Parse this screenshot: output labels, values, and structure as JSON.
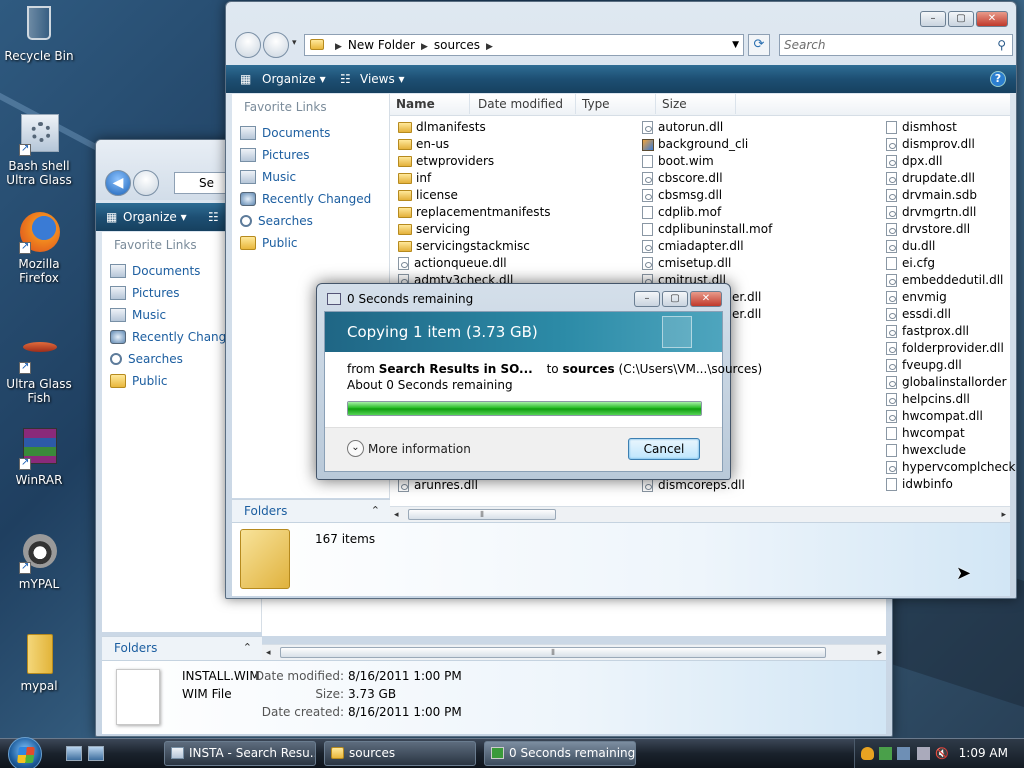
{
  "desktop": {
    "icons": [
      {
        "label": "Recycle Bin"
      },
      {
        "label": "Bash shell Ultra Glass"
      },
      {
        "label": "Mozilla Firefox"
      },
      {
        "label": "Ultra Glass Fish"
      },
      {
        "label": "WinRAR"
      },
      {
        "label": "mYPAL"
      },
      {
        "label": "mypal"
      }
    ]
  },
  "front_window": {
    "breadcrumb": [
      "New Folder",
      "sources"
    ],
    "search_placeholder": "Search",
    "toolbar": {
      "organize": "Organize",
      "views": "Views",
      "help": "?"
    },
    "favorite_links_header": "Favorite Links",
    "favorite_links": [
      "Documents",
      "Pictures",
      "Music",
      "Recently Changed",
      "Searches",
      "Public"
    ],
    "folders_label": "Folders",
    "columns": [
      "Name",
      "Date modified",
      "Type",
      "Size"
    ],
    "files_col1": [
      {
        "name": "dlmanifests",
        "kind": "folder"
      },
      {
        "name": "en-us",
        "kind": "folder"
      },
      {
        "name": "etwproviders",
        "kind": "folder"
      },
      {
        "name": "inf",
        "kind": "folder"
      },
      {
        "name": "license",
        "kind": "folder"
      },
      {
        "name": "replacementmanifests",
        "kind": "folder"
      },
      {
        "name": "servicing",
        "kind": "folder"
      },
      {
        "name": "servicingstackmisc",
        "kind": "folder"
      },
      {
        "name": "actionqueue.dll",
        "kind": "dll"
      },
      {
        "name": "admtv3check.dll",
        "kind": "dll"
      }
    ],
    "files_col1_bottom": "arunres.dll",
    "files_col2": [
      {
        "name": "autorun.dll",
        "kind": "dll"
      },
      {
        "name": "background_cli",
        "kind": "img"
      },
      {
        "name": "boot.wim",
        "kind": "file"
      },
      {
        "name": "cbscore.dll",
        "kind": "dll"
      },
      {
        "name": "cbsmsg.dll",
        "kind": "dll"
      },
      {
        "name": "cdplib.mof",
        "kind": "file"
      },
      {
        "name": "cdplibuninstall.mof",
        "kind": "file"
      },
      {
        "name": "cmiadapter.dll",
        "kind": "dll"
      },
      {
        "name": "cmisetup.dll",
        "kind": "dll"
      },
      {
        "name": "cmitrust.dll",
        "kind": "dll"
      }
    ],
    "files_col2_partial": [
      "er.dll",
      "er.dll",
      "ll"
    ],
    "files_col2_bottom": "dismcoreps.dll",
    "files_col3": [
      {
        "name": "dismhost",
        "kind": "file"
      },
      {
        "name": "dismprov.dll",
        "kind": "dll"
      },
      {
        "name": "dpx.dll",
        "kind": "dll"
      },
      {
        "name": "drupdate.dll",
        "kind": "dll"
      },
      {
        "name": "drvmain.sdb",
        "kind": "dll"
      },
      {
        "name": "drvmgrtn.dll",
        "kind": "dll"
      },
      {
        "name": "drvstore.dll",
        "kind": "dll"
      },
      {
        "name": "du.dll",
        "kind": "dll"
      },
      {
        "name": "ei.cfg",
        "kind": "file"
      },
      {
        "name": "embeddedutil.dll",
        "kind": "dll"
      },
      {
        "name": "envmig",
        "kind": "dll"
      },
      {
        "name": "essdi.dll",
        "kind": "dll"
      },
      {
        "name": "fastprox.dll",
        "kind": "dll"
      },
      {
        "name": "folderprovider.dll",
        "kind": "dll"
      },
      {
        "name": "fveupg.dll",
        "kind": "dll"
      },
      {
        "name": "globalinstallorder",
        "kind": "dll"
      },
      {
        "name": "helpcins.dll",
        "kind": "dll"
      },
      {
        "name": "hwcompat.dll",
        "kind": "dll"
      },
      {
        "name": "hwcompat",
        "kind": "file"
      },
      {
        "name": "hwexclude",
        "kind": "file"
      },
      {
        "name": "hypervcomplcheck.dll",
        "kind": "dll"
      },
      {
        "name": "idwbinfo",
        "kind": "file"
      }
    ],
    "item_count": "167 items"
  },
  "back_window": {
    "address_partial": "Se",
    "toolbar": {
      "organize": "Organize"
    },
    "favorite_links_header": "Favorite Links",
    "favorite_links": [
      "Documents",
      "Pictures",
      "Music",
      "Recently Changed",
      "Searches",
      "Public"
    ],
    "folders_label": "Folders",
    "details": {
      "file_name": "INSTALL.WIM",
      "file_type": "WIM File",
      "date_modified_label": "Date modified:",
      "date_modified": "8/16/2011 1:00 PM",
      "size_label": "Size:",
      "size": "3.73 GB",
      "date_created_label": "Date created:",
      "date_created": "8/16/2011 1:00 PM"
    }
  },
  "copy_dialog": {
    "title": "0 Seconds remaining",
    "heading": "Copying 1 item (3.73 GB)",
    "from_label": "from",
    "from_value": "Search Results in SO...",
    "to_label": "to",
    "to_value": "sources",
    "to_path": "(C:\\Users\\VM...\\sources)",
    "remaining": "About 0 Seconds remaining",
    "progress_fraction": 1.0,
    "more_info": "More information",
    "cancel": "Cancel"
  },
  "taskbar": {
    "tasks": [
      {
        "label": "INSTA - Search Resu..."
      },
      {
        "label": "sources"
      },
      {
        "label": "0 Seconds remaining"
      }
    ],
    "clock": "1:09 AM"
  },
  "colors": {
    "toolbar": "#1d4f73",
    "link": "#1c5ea0",
    "progress": "#19b619"
  }
}
